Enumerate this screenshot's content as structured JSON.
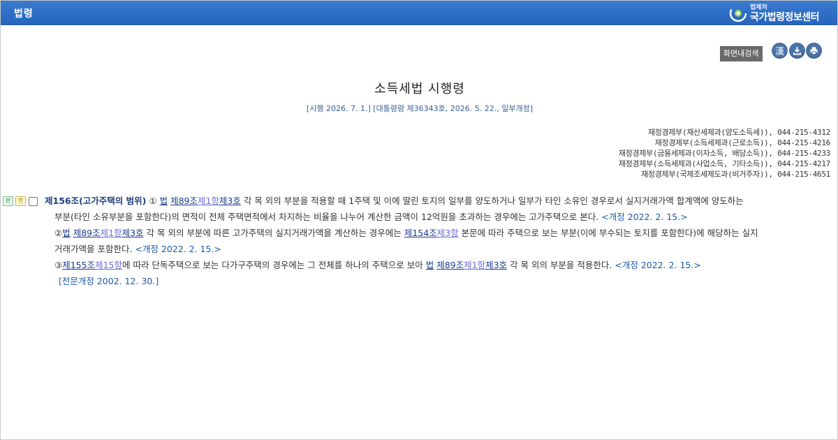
{
  "header": {
    "title": "법령",
    "brand_sub": "법제처",
    "brand_main": "국가법령정보센터"
  },
  "tools": {
    "find_label": "화면내검색",
    "hanja_label": "漢"
  },
  "law": {
    "title": "소득세법 시행령",
    "meta": "[시행 2026. 7. 1.] [대통령령 제36343호, 2026. 5. 22., 일부개정]",
    "contacts": [
      "재정경제부(재산세제과(양도소득세)), 044-215-4312",
      "재정경제부(소득세제과(근로소득)), 044-215-4216",
      "재정경제부(금융세제과(이자소득, 배당소득)), 044-215-4233",
      "재정경제부(소득세제과(사업소득, 기타소득)), 044-215-4217",
      "재정경제부(국제조세제도과(비거주자)), 044-215-4651"
    ]
  },
  "article": {
    "badge_pan": "판",
    "badge_yeon": "연",
    "title": "제156조(고가주택의 범위)",
    "p1": {
      "num": "①",
      "ref_law": "법",
      "ref_jo": "제89조",
      "ref_hang": "제1항",
      "ref_ho": "제3호",
      "text1": "각 목 외의 부분을 적용할 때 1주택 및 이에 딸린 토지의 일부를 양도하거나 일부가 타인 소유인 경우로서 실지거래가액 합계액에 양도하는",
      "text2": "부분(타인 소유부분을 포함한다)의 면적이 전체 주택면적에서 차지하는 비율을 나누어 계산한 금액이 12억원을 초과하는 경우에는 고가주택으로 본다.",
      "amend": "<개정 2022. 2. 15.>"
    },
    "p2": {
      "num": "②",
      "ref_law": "법",
      "ref_jo": "제89조",
      "ref_hang": "제1항",
      "ref_ho": "제3호",
      "text1": "각 목 외의 부분에 따른 고가주택의 실지거래가액을 계산하는 경우에는",
      "ref2_jo": "제154조",
      "ref2_hang": "제3항",
      "text2": "본문에 따라 주택으로 보는 부분(이에 부수되는 토지를 포함한다)에 해당하는 실지",
      "text3": "거래가액을 포함한다.",
      "amend": "<개정 2022. 2. 15.>"
    },
    "p3": {
      "num": "③",
      "ref_jo": "제155조",
      "ref_hang": "제15항",
      "text1": "에 따라 단독주택으로 보는 다가구주택의 경우에는 그 전체를 하나의 주택으로 보아",
      "ref_law": "법",
      "ref2_jo": "제89조",
      "ref2_hang": "제1항",
      "ref2_ho": "제3호",
      "text2": "각 목 외의 부분을 적용한다.",
      "amend": "<개정 2022. 2. 15.>"
    },
    "full_amend": "[전문개정 2002. 12. 30.]"
  }
}
